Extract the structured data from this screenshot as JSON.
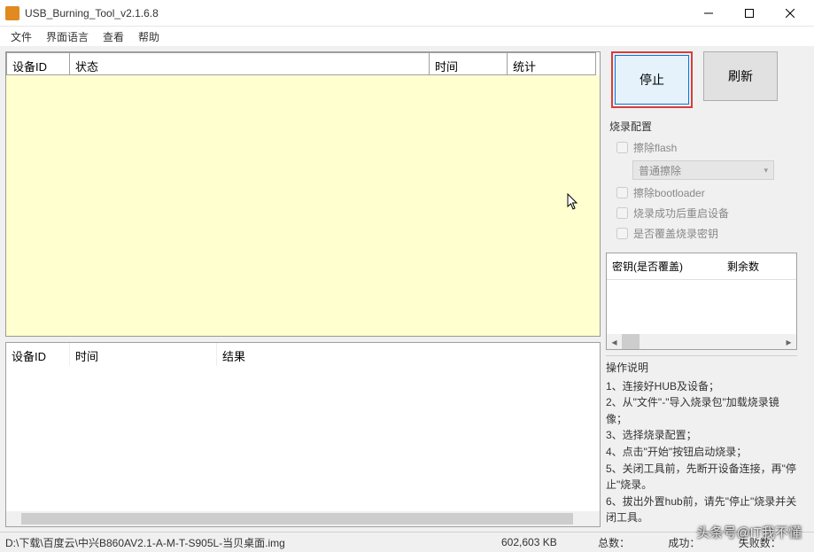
{
  "window": {
    "title": "USB_Burning_Tool_v2.1.6.8"
  },
  "menu": {
    "file": "文件",
    "language": "界面语言",
    "view": "查看",
    "help": "帮助"
  },
  "top_table": {
    "headers": {
      "device_id": "设备ID",
      "status": "状态",
      "time": "时间",
      "stats": "统计"
    }
  },
  "bottom_table": {
    "headers": {
      "device_id": "设备ID",
      "time": "时间",
      "result": "结果"
    }
  },
  "buttons": {
    "stop": "停止",
    "refresh": "刷新"
  },
  "config": {
    "title": "烧录配置",
    "erase_flash": "擦除flash",
    "erase_mode": "普通擦除",
    "erase_bootloader": "擦除bootloader",
    "reboot_after": "烧录成功后重启设备",
    "overwrite_key": "是否覆盖烧录密钥"
  },
  "key_table": {
    "col1": "密钥(是否覆盖)",
    "col2": "剩余数"
  },
  "instructions": {
    "title": "操作说明",
    "l1": "1、连接好HUB及设备；",
    "l2": "2、从\"文件\"-\"导入烧录包\"加载烧录镜像；",
    "l3": "3、选择烧录配置；",
    "l4": "4、点击\"开始\"按钮启动烧录；",
    "l5": "5、关闭工具前，先断开设备连接，再\"停止\"烧录。",
    "l6": "6、拔出外置hub前，请先\"停止\"烧录并关闭工具。"
  },
  "status": {
    "path": "D:\\下载\\百度云\\中兴B860AV2.1-A-M-T-S905L-当贝桌面.img",
    "size": "602,603 KB",
    "total": "总数：",
    "success": "成功：",
    "fail": "失败数："
  },
  "watermark": "头条号@IT我不懂"
}
